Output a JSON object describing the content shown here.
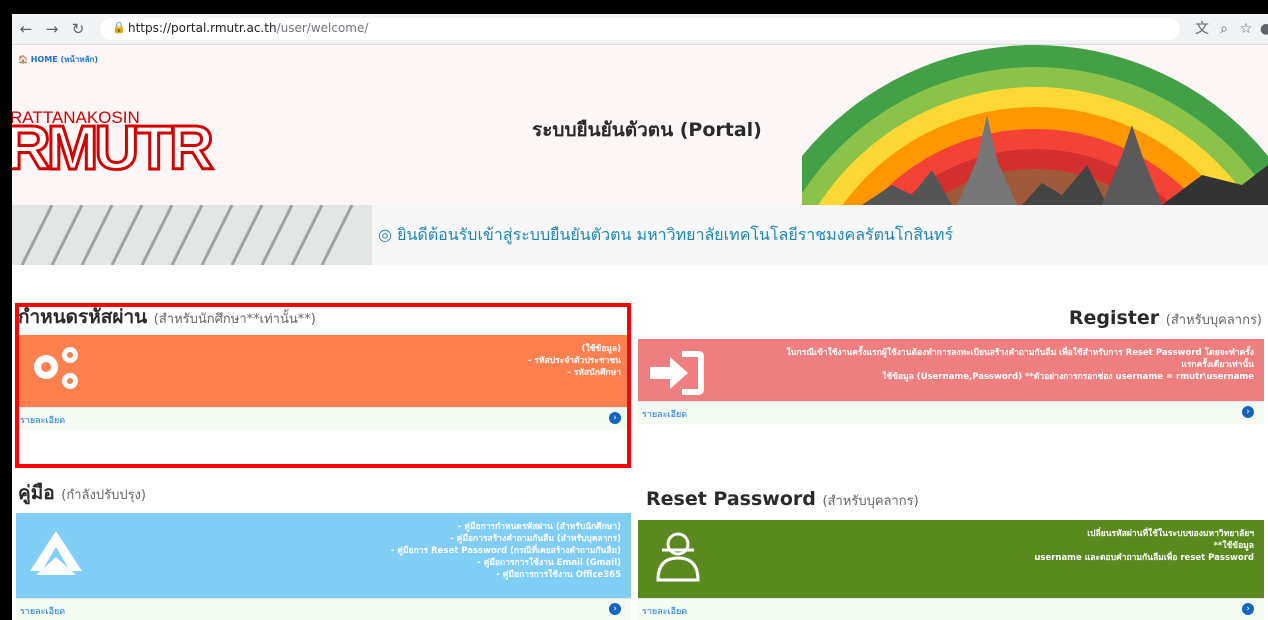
{
  "browser": {
    "url_host": "https://portal.rmutr.ac.th",
    "url_path": "/user/welcome/"
  },
  "header": {
    "home_link": "HOME (หน้าหลัก)",
    "logo_small": "RATTANAKOSIN",
    "logo_big": "RMUTR",
    "title": "ระบบยืนยันตัวตน (Portal)"
  },
  "banner": {
    "welcome": "ยินดีต้อนรับเข้าสู่ระบบยืนยันตัวตน มหาวิทยาลัยเทคโนโลยีราชมงคลรัตนโกสินทร์"
  },
  "sections": {
    "set_password": {
      "title": "กำหนดรหัสผ่าน",
      "subtitle": "(สำหรับนักศึกษา**เท่านั้น**)",
      "lines": [
        "(ใช้ข้อมูล)",
        "- รหัสประจำตัวประชาชน",
        "- รหัสนักศึกษา"
      ],
      "details": "รายละเอียด",
      "color": "#ff7f4f"
    },
    "register": {
      "title": "Register",
      "subtitle": "(สำหรับบุคลากร)",
      "lines": [
        "ในกรณีเข้าใช้งานครั้งแรกผู้ใช้งานต้องทำการลงทะเบียนสร้างคำถามกันลืม เพื่อใช้สำหรับการ Reset Password โดยจะทำครั้ง",
        "แรกครั้งเดียวเท่านั้น",
        "ใช้ข้อมูล (Username,Password) **ตัวอย่างการกรอกช่อง username = rmutr\\username"
      ],
      "details": "รายละเอียด",
      "color": "#ef7f7f"
    },
    "manual": {
      "title": "คู่มือ",
      "subtitle": "(กำลังปรับปรุง)",
      "lines": [
        "- คู่มือการกำหนดรหัสผ่าน (สำหรับนักศึกษา)",
        "- คู่มือการสร้างคำถามกันลืม (สำหรับบุคลากร)",
        "- คู่มือการ Reset Password (กรณีที่เคยสร้างคำถามกันลืม)",
        "- คู่มือการการใช้งาน Email (Gmail)",
        "- คู่มือการการใช้งาน Office365"
      ],
      "details": "รายละเอียด",
      "color": "#80cdf5"
    },
    "reset": {
      "title": "Reset Password",
      "subtitle": "(สำหรับบุคลากร)",
      "lines": [
        "เปลี่ยนรหัสผ่านที่ใช้ในระบบของมหาวิทยาลัยฯ",
        "**ใช้ข้อมูล",
        "username และตอบคำถามกันลืมเพื่อ reset Password"
      ],
      "details": "รายละเอียด",
      "color": "#5a8a1f"
    }
  }
}
